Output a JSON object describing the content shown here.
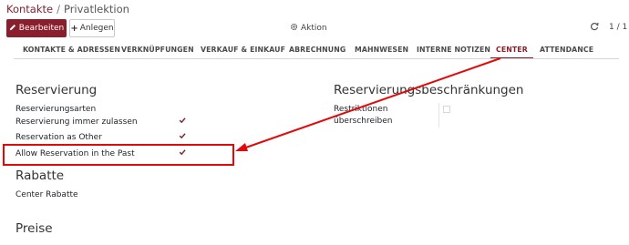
{
  "breadcrumb": {
    "parent": "Kontakte",
    "separator": "/",
    "current": "Privatlektion"
  },
  "toolbar": {
    "edit_label": "Bearbeiten",
    "create_label": "Anlegen",
    "action_label": "Aktion",
    "pager": "1 / 1"
  },
  "tabs": [
    {
      "label": "KONTAKTE & ADRESSEN"
    },
    {
      "label": "VERKNÜPFUNGEN"
    },
    {
      "label": "VERKAUF & EINKAUF"
    },
    {
      "label": "ABRECHNUNG"
    },
    {
      "label": "MAHNWESEN"
    },
    {
      "label": "INTERNE NOTIZEN"
    },
    {
      "label": "CENTER"
    },
    {
      "label": "ATTENDANCE"
    }
  ],
  "active_tab": "CENTER",
  "reservierung": {
    "title": "Reservierung",
    "fields": [
      {
        "label": "Reservierungsarten",
        "checked": null
      },
      {
        "label": "Reservierung immer zulassen",
        "checked": true
      },
      {
        "label": "Reservation as Other",
        "checked": true
      },
      {
        "label": "Allow Reservation in the Past",
        "checked": true
      }
    ]
  },
  "beschraenkungen": {
    "title": "Reservierungsbeschränkungen",
    "field_line1": "Restriktionen",
    "field_line2": "überschreiben",
    "checked": false
  },
  "rabatte": {
    "title": "Rabatte",
    "field": "Center Rabatte"
  },
  "preise": {
    "title": "Preise"
  },
  "colors": {
    "brand": "#8a1e2c",
    "annotation": "#e10a0a"
  },
  "icons": {
    "edit": "pencil-icon",
    "create": "plus-icon",
    "action": "gear-icon",
    "refresh": "refresh-icon",
    "check": "checkmark-icon"
  }
}
